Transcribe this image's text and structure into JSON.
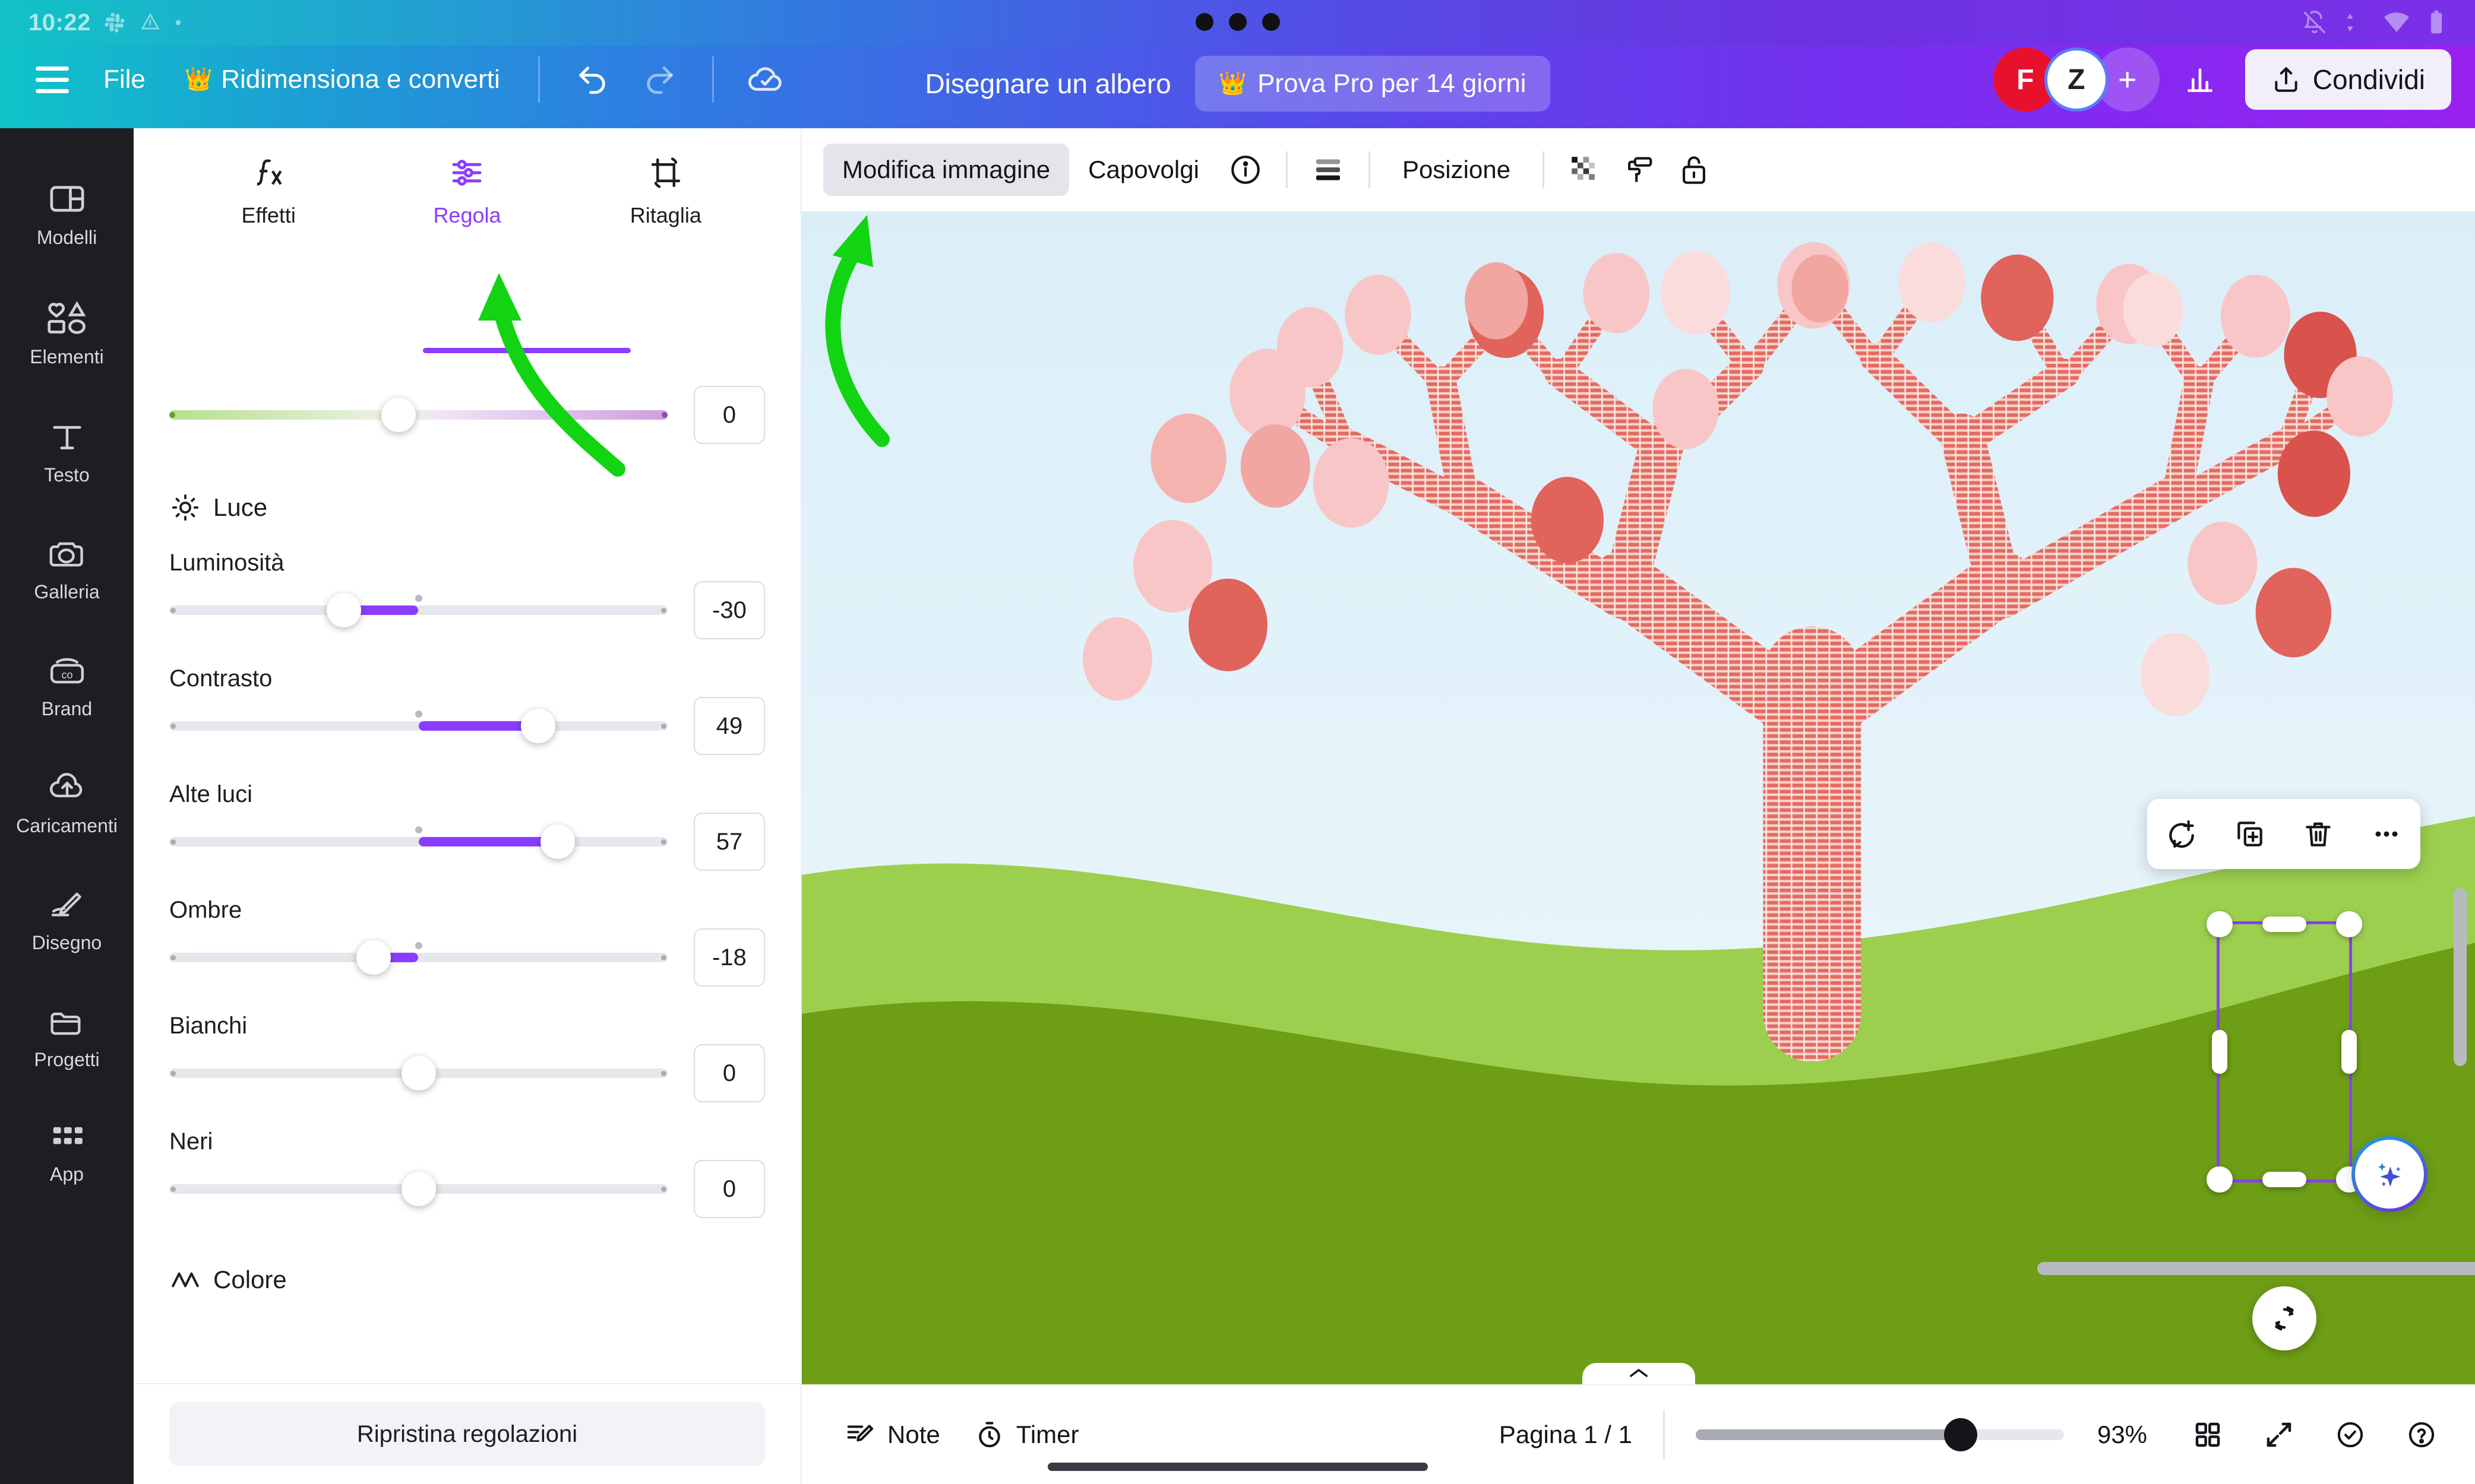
{
  "os": {
    "time": "10:22",
    "icons": [
      "slack-icon",
      "drive-icon",
      "dot-icon"
    ],
    "tray": [
      "bell-off-icon",
      "data-transfer-icon",
      "wifi-icon",
      "battery-icon"
    ]
  },
  "header": {
    "menu_icon": "hamburger-icon",
    "file_label": "File",
    "resize_label": "Ridimensiona e converti",
    "resize_badge": "crown-icon",
    "undo_icon": "undo-icon",
    "redo_icon": "redo-icon",
    "cloud_icon": "cloud-saved-icon",
    "doc_title": "Disegnare un albero",
    "pro_label": "Prova Pro per 14 giorni",
    "pro_badge": "crown-icon",
    "avatars": [
      {
        "initial": "F",
        "color": "#e8112d"
      },
      {
        "initial": "Z",
        "color": "#ffffff"
      }
    ],
    "add_collaborator": "+",
    "insights_icon": "bar-chart-icon",
    "share_label": "Condividi",
    "share_icon": "share-upload-icon"
  },
  "rail": {
    "items": [
      {
        "label": "Modelli",
        "icon": "templates-icon"
      },
      {
        "label": "Elementi",
        "icon": "elements-icon"
      },
      {
        "label": "Testo",
        "icon": "text-icon"
      },
      {
        "label": "Galleria",
        "icon": "gallery-camera-icon"
      },
      {
        "label": "Brand",
        "icon": "brand-icon"
      },
      {
        "label": "Caricamenti",
        "icon": "uploads-cloud-icon"
      },
      {
        "label": "Disegno",
        "icon": "draw-pen-icon"
      },
      {
        "label": "Progetti",
        "icon": "projects-folder-icon"
      },
      {
        "label": "App",
        "icon": "apps-grid-icon"
      }
    ]
  },
  "panel": {
    "tabs": [
      {
        "label": "Effetti",
        "icon": "fx-icon",
        "active": false
      },
      {
        "label": "Regola",
        "icon": "adjust-sliders-icon",
        "active": true
      },
      {
        "label": "Ritaglia",
        "icon": "crop-icon",
        "active": false
      }
    ],
    "top_slider": {
      "value": "0",
      "knob_pct": 46,
      "icon": "duotone-gradient-slider"
    },
    "light_section": {
      "title": "Luce",
      "icon": "brightness-sun-icon"
    },
    "sliders": [
      {
        "name": "Luminosità",
        "value": "-30",
        "knob_pct": 35,
        "mark_pct": 50,
        "fill_from_pct": 35,
        "fill_to_pct": 50
      },
      {
        "name": "Contrasto",
        "value": "49",
        "knob_pct": 74,
        "mark_pct": 50,
        "fill_from_pct": 50,
        "fill_to_pct": 74
      },
      {
        "name": "Alte luci",
        "value": "57",
        "knob_pct": 78,
        "mark_pct": 50,
        "fill_from_pct": 50,
        "fill_to_pct": 78
      },
      {
        "name": "Ombre",
        "value": "-18",
        "knob_pct": 41,
        "mark_pct": 50,
        "fill_from_pct": 41,
        "fill_to_pct": 50
      },
      {
        "name": "Bianchi",
        "value": "0",
        "knob_pct": 50,
        "mark_pct": 50,
        "fill_from_pct": 50,
        "fill_to_pct": 50
      },
      {
        "name": "Neri",
        "value": "0",
        "knob_pct": 50,
        "mark_pct": 50,
        "fill_from_pct": 50,
        "fill_to_pct": 50
      }
    ],
    "color_section": {
      "title": "Colore",
      "icon": "color-mountains-icon"
    },
    "reset_label": "Ripristina regolazioni"
  },
  "canvas_toolbar": {
    "edit_image_label": "Modifica immagine",
    "flip_label": "Capovolgi",
    "info_icon": "info-circle-icon",
    "layers_icon": "layers-icon",
    "position_label": "Posizione",
    "transparency_icon": "transparency-checker-icon",
    "style_copy_icon": "paint-roller-icon",
    "lock_icon": "lock-open-icon"
  },
  "float_toolbar": {
    "comment_icon": "add-comment-icon",
    "duplicate_icon": "duplicate-icon",
    "delete_icon": "trash-icon",
    "more_icon": "more-dots-icon"
  },
  "selection": {
    "rotate_icon": "rotate-icon",
    "handles": 8
  },
  "ai_fab": {
    "icon": "magic-sparkles-icon"
  },
  "bottom": {
    "notes_label": "Note",
    "notes_icon": "notes-icon",
    "timer_label": "Timer",
    "timer_icon": "timer-icon",
    "page_label": "Pagina 1 / 1",
    "zoom_value": "93%",
    "zoom_pct": 72,
    "grid_icon": "grid-view-icon",
    "fullscreen_icon": "fullscreen-icon",
    "approve_icon": "check-circle-icon",
    "help_icon": "help-circle-icon",
    "collapse_icon": "chevron-up-icon"
  },
  "artwork": {
    "title": "tree-illustration",
    "sky_top": "#dff0f8",
    "sky_bottom": "#eef9fc",
    "hill_light": "#9ccf4e",
    "hill_dark": "#6e9d16",
    "tree_color": "#e4695f",
    "blossom_light": "#f8c6c6",
    "blossom_dark": "#e0635c"
  },
  "annotations": [
    {
      "name": "arrow-to-regola-tab",
      "color": "#12d412"
    },
    {
      "name": "arrow-to-modifica-immagine",
      "color": "#12d412"
    }
  ]
}
